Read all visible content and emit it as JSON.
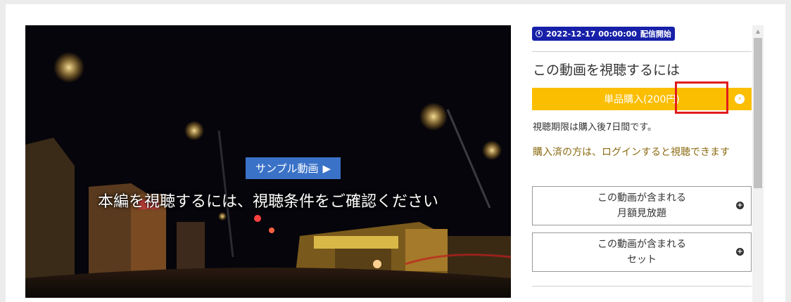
{
  "video": {
    "sample_button_label": "サンプル動画",
    "caption": "本編を視聴するには、視聴条件をご確認ください"
  },
  "sidebar": {
    "date_badge": "2022-12-17 00:00:00",
    "date_badge_suffix": "配信開始",
    "heading": "この動画を視聴するには",
    "buy_button_label": "単品購入(200円)",
    "period_note": "視聴期限は購入後7日間です。",
    "login_note": "購入済の方は、ログインすると視聴できます",
    "options": [
      {
        "line1": "この動画が含まれる",
        "line2": "月額見放題"
      },
      {
        "line1": "この動画が含まれる",
        "line2": "セット"
      }
    ]
  },
  "colors": {
    "accent_yellow": "#fbbe00",
    "badge_blue": "#1620a8",
    "sample_blue": "#3a72c8",
    "highlight_red": "#e01c1c",
    "note_brown": "#8a6a10"
  },
  "icons": {
    "clock": "clock-icon",
    "play": "play-icon",
    "arrow": "arrow-right-circle-icon",
    "plus": "plus-circle-icon"
  }
}
